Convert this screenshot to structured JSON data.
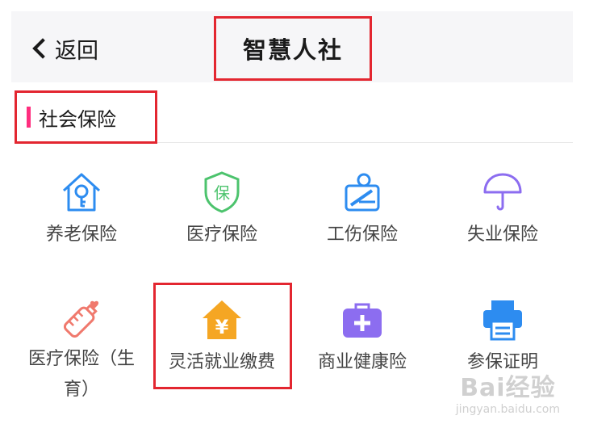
{
  "header": {
    "back_label": "返回",
    "title": "智慧人社"
  },
  "section": {
    "title": "社会保险"
  },
  "tiles": [
    {
      "label": "养老保险",
      "icon": "pension-house-icon"
    },
    {
      "label": "医疗保险",
      "icon": "medical-shield-icon"
    },
    {
      "label": "工伤保险",
      "icon": "work-injury-icon"
    },
    {
      "label": "失业保险",
      "icon": "umbrella-icon"
    },
    {
      "label": "医疗保险（生育）",
      "icon": "baby-bottle-icon"
    },
    {
      "label": "灵活就业缴费",
      "icon": "house-yen-icon"
    },
    {
      "label": "商业健康险",
      "icon": "medical-kit-icon"
    },
    {
      "label": "参保证明",
      "icon": "printer-icon"
    }
  ],
  "watermark": {
    "logo": "Bai经验",
    "url": "jingyan.baidu.com"
  },
  "colors": {
    "blue": "#2d8cf0",
    "green": "#4cc36d",
    "purple": "#8c6df0",
    "salmon": "#f0796d",
    "orange": "#f5a623",
    "highlight_red": "#e32630",
    "accent_pink": "#ff2e7e"
  }
}
